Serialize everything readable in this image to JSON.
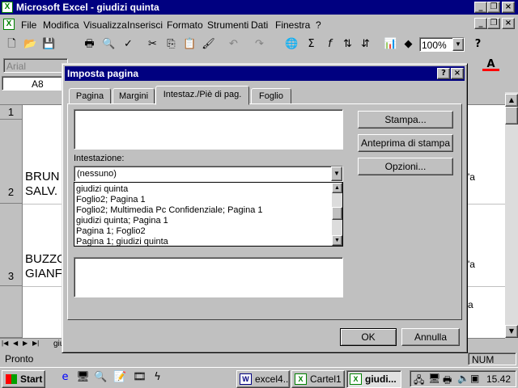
{
  "app": {
    "title": "Microsoft Excel - giudizi quinta",
    "icon": "excel-icon"
  },
  "menu": {
    "items": [
      "File",
      "Modifica",
      "Visualizza",
      "Inserisci",
      "Formato",
      "Strumenti",
      "Dati",
      "Finestra",
      "?"
    ]
  },
  "toolbar": {
    "zoom": "100%",
    "help": "?"
  },
  "format": {
    "font": "Arial"
  },
  "formula": {
    "cell_ref": "A8"
  },
  "grid": {
    "rows": [
      "1",
      "2",
      "3"
    ],
    "cells": {
      "r2_line1": "BRUN",
      "r2_line2": "SALV.",
      "r3_line1": "BUZZO",
      "r3_line2": "GIANF",
      "right2": "'a",
      "right3": "'a",
      "right4": "a"
    }
  },
  "sheet": {
    "tab": "giu"
  },
  "status": {
    "text": "Pronto",
    "num": "NUM"
  },
  "taskbar": {
    "start": "Start",
    "clock": "15.42",
    "tasks": [
      {
        "label": "excel4..."
      },
      {
        "label": "Cartel1"
      },
      {
        "label": "giudi..."
      }
    ]
  },
  "dialog": {
    "title": "Imposta pagina",
    "help": "?",
    "close": "×",
    "tabs": [
      "Pagina",
      "Margini",
      "Intestaz./Piè di pag.",
      "Foglio"
    ],
    "header_label": "Intestazione:",
    "header_selected": "(nessuno)",
    "header_options": [
      "giudizi quinta",
      "Foglio2; Pagina 1",
      "Foglio2; Multimedia Pc Confidenziale; Pagina 1",
      "giudizi quinta; Pagina 1",
      "Pagina 1; Foglio2",
      "Pagina 1; giudizi quinta"
    ],
    "buttons": {
      "print": "Stampa...",
      "preview": "Anteprima di stampa",
      "options": "Opzioni...",
      "ok": "OK",
      "cancel": "Annulla"
    }
  }
}
